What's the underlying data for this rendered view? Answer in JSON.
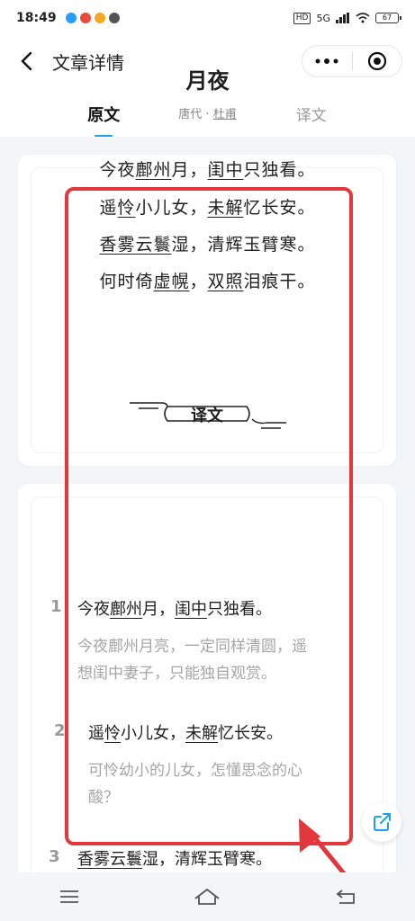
{
  "status_bar": {
    "time": "18:49",
    "network": "5G",
    "hd": "HD",
    "battery": "67"
  },
  "navbar": {
    "title": "文章详情",
    "back_icon": "chevron-left-icon",
    "more_icon": "more-dots-icon",
    "close_icon": "target-circle-icon"
  },
  "tabs": [
    {
      "label": "原文",
      "active": true
    },
    {
      "label": "译文",
      "active": false
    }
  ],
  "poem": {
    "title": "月夜",
    "dynasty": "唐代",
    "separator": "·",
    "author": "杜甫",
    "lines": [
      {
        "parts": [
          {
            "t": "今夜",
            "u": false
          },
          {
            "t": "鄜州",
            "u": true
          },
          {
            "t": "月，",
            "u": false
          },
          {
            "t": "闺中",
            "u": true
          },
          {
            "t": "只独看。",
            "u": false
          }
        ]
      },
      {
        "parts": [
          {
            "t": "遥",
            "u": false
          },
          {
            "t": "怜",
            "u": true
          },
          {
            "t": "小儿女，",
            "u": false
          },
          {
            "t": "未解",
            "u": true
          },
          {
            "t": "忆长安。",
            "u": false
          }
        ]
      },
      {
        "parts": [
          {
            "t": "香雾云鬟",
            "u": true
          },
          {
            "t": "湿，清辉玉臂寒。",
            "u": false
          }
        ]
      },
      {
        "parts": [
          {
            "t": "何时倚",
            "u": false
          },
          {
            "t": "虚幌",
            "u": true
          },
          {
            "t": "，",
            "u": false
          },
          {
            "t": "双照",
            "u": true
          },
          {
            "t": "泪痕干。",
            "u": false
          }
        ]
      }
    ]
  },
  "translation": {
    "heading": "译文",
    "items": [
      {
        "num": "1",
        "verse": [
          {
            "t": "今夜",
            "u": false
          },
          {
            "t": "鄜州",
            "u": true
          },
          {
            "t": "月，",
            "u": false
          },
          {
            "t": "闺中",
            "u": true
          },
          {
            "t": "只独看。",
            "u": false
          }
        ],
        "text_line1": "今夜鄜州月亮，一定同样清圆，遥",
        "text_line2": "想闺中妻子，只能独自观赏。"
      },
      {
        "num": "2",
        "verse": [
          {
            "t": "遥",
            "u": false
          },
          {
            "t": "怜",
            "u": true
          },
          {
            "t": "小儿女，",
            "u": false
          },
          {
            "t": "未解",
            "u": true
          },
          {
            "t": "忆长安。",
            "u": false
          }
        ],
        "text_line1": "可怜幼小的儿女，怎懂思念的心",
        "text_line2": "酸？"
      },
      {
        "num": "3",
        "verse": [
          {
            "t": "香雾云鬟",
            "u": true
          },
          {
            "t": "湿，清辉玉臂寒。",
            "u": false
          }
        ]
      }
    ]
  },
  "share_icon": "share-icon",
  "bottom_nav": [
    "menu-icon",
    "home-icon",
    "back-icon"
  ],
  "colors": {
    "accent": "#1ea0e6",
    "highlight": "#e2373c",
    "muted": "#a5a5a5"
  }
}
